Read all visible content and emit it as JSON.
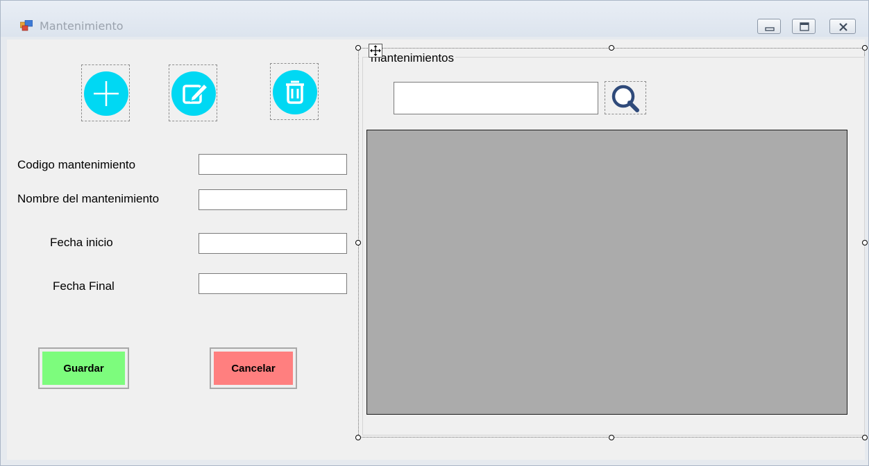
{
  "window": {
    "title": "Mantenimiento",
    "controls": {
      "minimize": "minimize-icon",
      "maximize": "maximize-icon",
      "close": "close-icon"
    }
  },
  "toolbar": {
    "icons": [
      "add-icon",
      "edit-icon",
      "delete-icon"
    ],
    "accent_color": "#00d8f3"
  },
  "form": {
    "codigo_label": "Codigo mantenimiento",
    "nombre_label": "Nombre del mantenimiento",
    "fecha_inicio_label": "Fecha inicio",
    "fecha_final_label": "Fecha Final",
    "codigo_value": "",
    "nombre_value": "",
    "fecha_inicio_value": "",
    "fecha_final_value": ""
  },
  "buttons": {
    "guardar_label": "Guardar",
    "guardar_color": "#7dfc7d",
    "cancelar_label": "Cancelar",
    "cancelar_color": "#ff7f7f"
  },
  "group": {
    "title": "mantenimientos",
    "search_value": "",
    "search_icon": "magnifier-icon",
    "grid_color": "#ababab"
  }
}
